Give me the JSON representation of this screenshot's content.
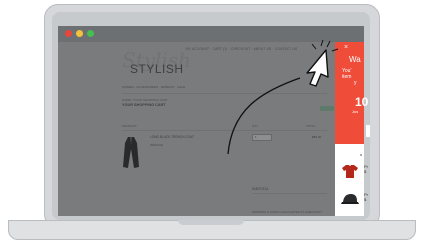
{
  "store": {
    "logo_script": "Stylish",
    "logo": "STYLISH",
    "top_nav": "MY ACCOUNT · CART (1) · CHECKOUT · ABOUT US · CONTACT US",
    "main_nav": "WOMEN · ACCESSORIES · JEWELRY · SALE",
    "breadcrumb": "HOME / YOUR SHOPPING CART",
    "page_title": "YOUR SHOPPING CART",
    "col_product": "PRODUCT",
    "col_qty": "QTY",
    "col_total": "TOTAL",
    "product_name": "LONG BLACK TRENCH COAT",
    "product_remove": "REMOVE",
    "qty_value": "1",
    "price": "$89.00",
    "subtotal_label": "SUBTOTAL",
    "shipping_note": "SHIPPING & TAXES CALCULATED AT CHECKOUT"
  },
  "popup": {
    "close": "×",
    "heading": "Wa",
    "sub_line1": "You'",
    "sub_line2": "item",
    "sub_line3": "y",
    "big": "10",
    "small": "Jus",
    "section_title": "R",
    "items": [
      {
        "icon": "tshirt-icon",
        "text1": "Pr",
        "text2": "$"
      },
      {
        "icon": "cap-icon",
        "text1": "Pr",
        "text2": "$"
      }
    ]
  },
  "colors": {
    "popup_accent": "#ef4c3a",
    "dot_red": "#e8463b",
    "dot_yellow": "#f2c23a",
    "dot_green": "#43c04e"
  }
}
